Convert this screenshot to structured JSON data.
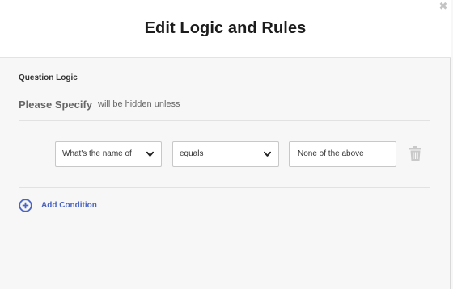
{
  "modal": {
    "title": "Edit Logic and Rules",
    "close_symbol": "✖"
  },
  "logic": {
    "section_label": "Question Logic",
    "question_name": "Please Specify",
    "hidden_text": "will be hidden unless"
  },
  "condition": {
    "question_select_value": "What's the name of",
    "operator_select_value": "equals",
    "value_input": "None of the above"
  },
  "actions": {
    "add_condition_label": "Add Condition"
  },
  "colors": {
    "accent": "#4a64c4",
    "trash": "#c9c9c9"
  },
  "icons": {
    "close": "close-icon",
    "chevron": "chevron-down-icon",
    "trash": "trash-icon",
    "add": "plus-circle-icon"
  }
}
